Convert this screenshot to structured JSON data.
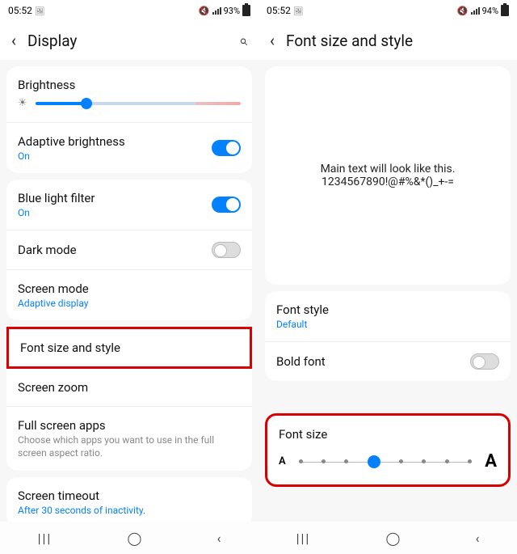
{
  "left": {
    "status": {
      "time": "05:52",
      "battery": "93%",
      "icon_photo": "🖼"
    },
    "header": {
      "back": "‹",
      "title": "Display",
      "search": "⌕"
    },
    "brightness_label": "Brightness",
    "items": {
      "adaptive_brightness": {
        "label": "Adaptive brightness",
        "sub": "On"
      },
      "blue_light": {
        "label": "Blue light filter",
        "sub": "On"
      },
      "dark_mode": {
        "label": "Dark mode"
      },
      "screen_mode": {
        "label": "Screen mode",
        "sub": "Adaptive display"
      },
      "font_size_style": {
        "label": "Font size and style"
      },
      "screen_zoom": {
        "label": "Screen zoom"
      },
      "full_screen": {
        "label": "Full screen apps",
        "sub": "Choose which apps you want to use in the full screen aspect ratio."
      },
      "screen_timeout": {
        "label": "Screen timeout",
        "sub": "After 30 seconds of inactivity."
      }
    }
  },
  "right": {
    "status": {
      "time": "05:52",
      "battery": "94%",
      "icon_photo": "🖼"
    },
    "header": {
      "back": "‹",
      "title": "Font size and style"
    },
    "preview": {
      "line1": "Main text will look like this.",
      "line2": "1234567890!@#%&*()_+-="
    },
    "items": {
      "font_style": {
        "label": "Font style",
        "sub": "Default"
      },
      "bold_font": {
        "label": "Bold font"
      },
      "font_size": {
        "label": "Font size"
      }
    },
    "A_small": "A",
    "A_large": "A"
  },
  "nav": {
    "recents": "|||",
    "home": "◯",
    "back": "‹"
  }
}
